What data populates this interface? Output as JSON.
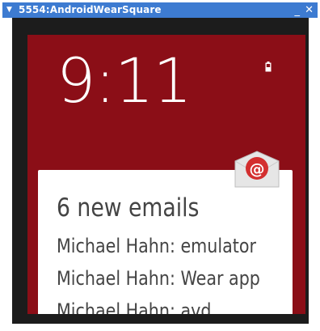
{
  "window": {
    "title": "5554:AndroidWearSquare",
    "menu_glyph": "▼",
    "minimize_glyph": "_",
    "close_glyph": "✕"
  },
  "watch": {
    "time": "9:11",
    "battery_icon": "battery-charging-icon",
    "notification": {
      "app_icon": "email-icon",
      "title": "6 new emails",
      "lines": [
        "Michael Hahn: emulator",
        "Michael Hahn: Wear app",
        "Michael Hahn: avd"
      ]
    }
  },
  "colors": {
    "titlebar": "#3d7bd1",
    "bezel": "#1c1c1c",
    "watch_background": "#8b0e17",
    "card": "#ffffff",
    "email_badge": "#d32f2f"
  }
}
